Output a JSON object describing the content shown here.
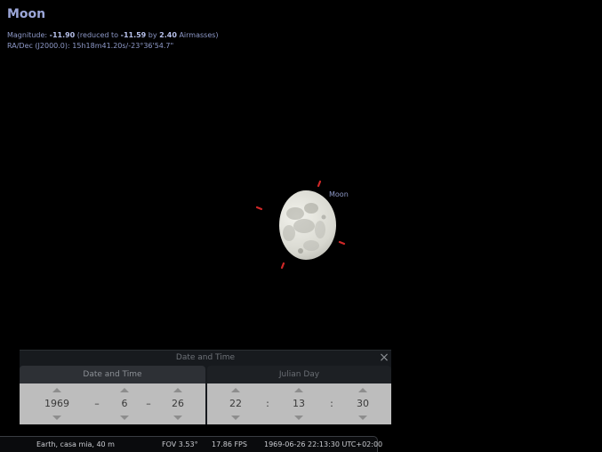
{
  "object": {
    "name": "Moon",
    "label": "Moon",
    "magnitude_prefix": "Magnitude: ",
    "magnitude": "-11.90",
    "reduced_prefix": " (reduced to ",
    "reduced_magnitude": "-11.59",
    "by_text": " by ",
    "airmasses": "2.40",
    "airmasses_suffix": " Airmasses)",
    "radec": "RA/Dec (J2000.0): 15h18m41.20s/-23°36'54.7\""
  },
  "date_time_dialog": {
    "title": "Date and Time",
    "tabs": [
      "Date and Time",
      "Julian Day"
    ],
    "date": {
      "year": "1969",
      "month": "6",
      "day": "26",
      "separator": "–"
    },
    "time": {
      "hour": "22",
      "minute": "13",
      "second": "30",
      "separator": ":"
    }
  },
  "status_bar": {
    "location": "Earth, casa mia, 40 m",
    "fov": "FOV 3.53°",
    "fps": "17.86 FPS",
    "datetime": "1969-06-26 22:13:30 UTC+02:00"
  },
  "colors": {
    "label": "#8e99c8",
    "marker": "#d02828",
    "background": "#000000"
  },
  "icons": {
    "close": "close-icon",
    "spin_up": "chevron-up-icon",
    "spin_down": "chevron-down-icon"
  }
}
